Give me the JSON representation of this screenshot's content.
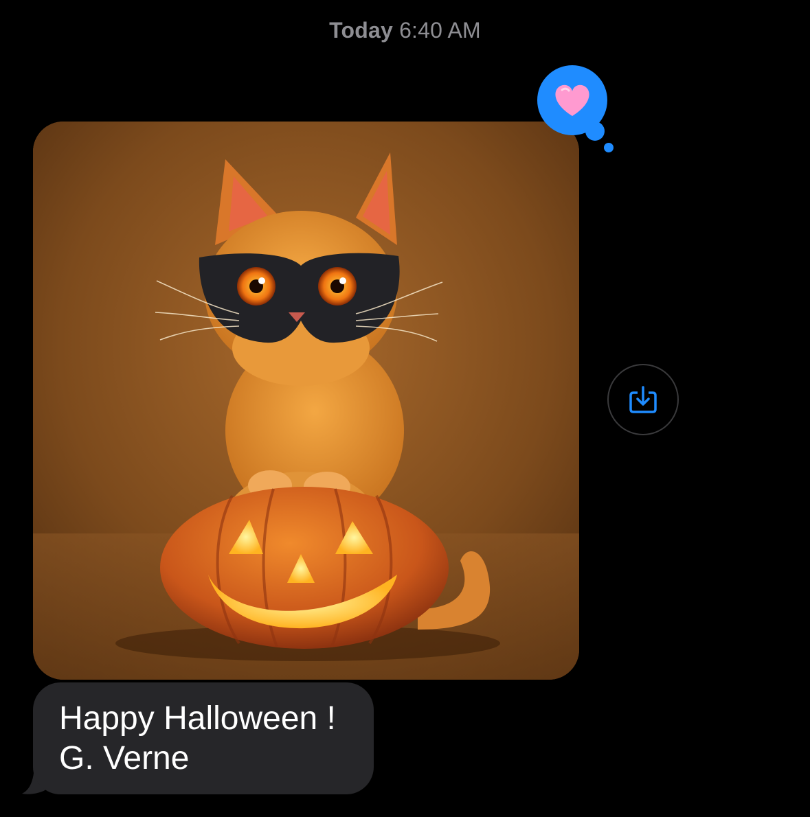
{
  "conversation": {
    "timestamp_day": "Today",
    "timestamp_time": "6:40 AM"
  },
  "message": {
    "image_alt": "Orange kitten wearing a black mask sitting on a carved jack-o'-lantern pumpkin",
    "tapback_icon": "heart-icon",
    "save_icon": "download-to-tray-icon",
    "text_lines": [
      "Happy Halloween !",
      "G. Verne"
    ]
  },
  "colors": {
    "background": "#000000",
    "bubble": "#262629",
    "accent": "#1f8cff",
    "heart": "#ff9ad0"
  }
}
